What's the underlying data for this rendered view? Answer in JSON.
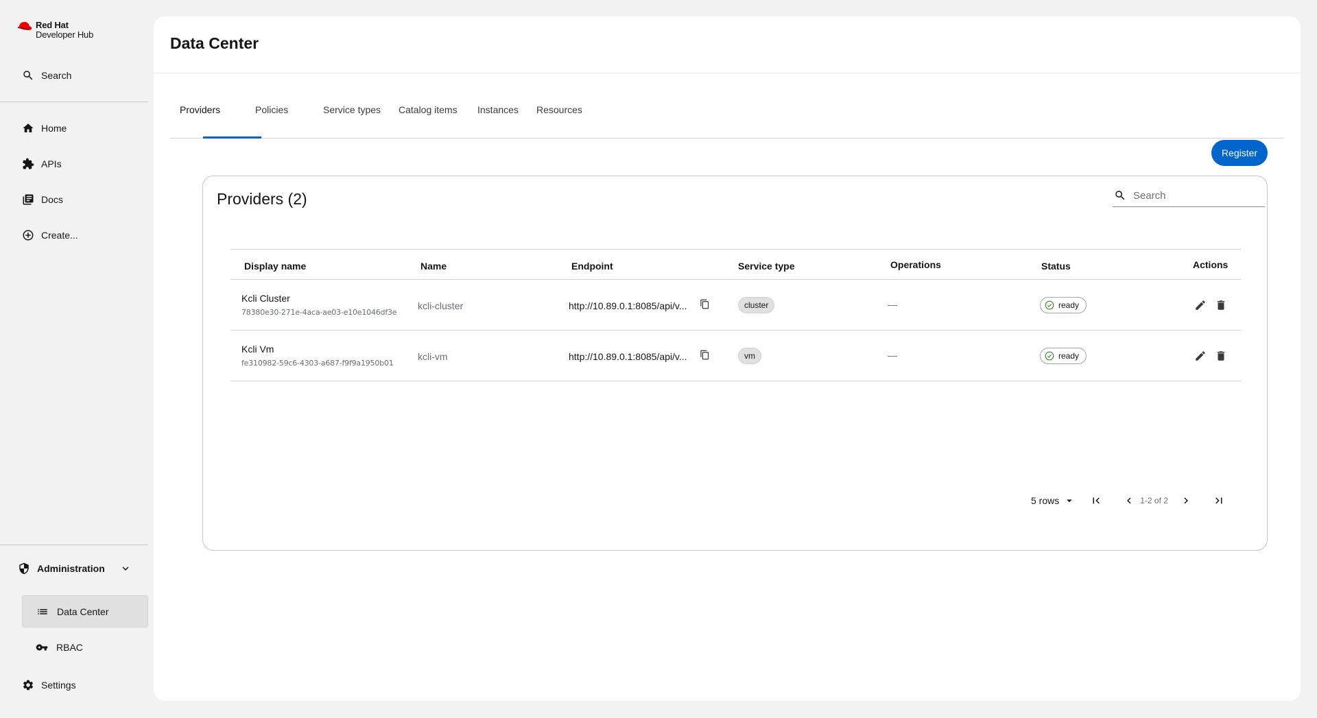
{
  "sidebar": {
    "logo": {
      "line1": "Red Hat",
      "line2": "Developer Hub"
    },
    "search_label": "Search",
    "items": [
      {
        "label": "Home",
        "icon": "home-icon"
      },
      {
        "label": "APIs",
        "icon": "puzzle-icon"
      },
      {
        "label": "Docs",
        "icon": "docs-icon"
      },
      {
        "label": "Create...",
        "icon": "add-circle-icon"
      }
    ],
    "admin": {
      "label": "Administration",
      "icon": "shield-icon",
      "sub_items": [
        {
          "label": "Data Center",
          "icon": "list-icon",
          "active": true
        },
        {
          "label": "RBAC",
          "icon": "key-icon",
          "active": false
        }
      ]
    },
    "settings_label": "Settings"
  },
  "header": {
    "title": "Data Center"
  },
  "tabs": [
    {
      "label": "Providers",
      "active": true
    },
    {
      "label": "Policies"
    },
    {
      "label": "Service types"
    },
    {
      "label": "Catalog items"
    },
    {
      "label": "Instances"
    },
    {
      "label": "Resources"
    }
  ],
  "register_label": "Register",
  "card": {
    "title": "Providers (2)",
    "search_placeholder": "Search"
  },
  "table": {
    "columns": [
      "Display name",
      "Name",
      "Endpoint",
      "Service type",
      "Operations",
      "Status",
      "Actions"
    ],
    "rows": [
      {
        "display_name": "Kcli Cluster",
        "id": "78380e30-271e-4aca-ae03-e10e1046df3e",
        "name": "kcli-cluster",
        "endpoint": "http://10.89.0.1:8085/api/v...",
        "service_type": "cluster",
        "operations": "—",
        "status": "ready"
      },
      {
        "display_name": "Kcli Vm",
        "id": "fe310982-59c6-4303-a687-f9f9a1950b01",
        "name": "kcli-vm",
        "endpoint": "http://10.89.0.1:8085/api/v...",
        "service_type": "vm",
        "operations": "—",
        "status": "ready"
      }
    ]
  },
  "pagination": {
    "rows_label": "5 rows",
    "range": "1-2 of 2"
  },
  "colors": {
    "accent": "#0066cc",
    "status_ok": "#3e8635",
    "logo_red": "#ee0000"
  }
}
